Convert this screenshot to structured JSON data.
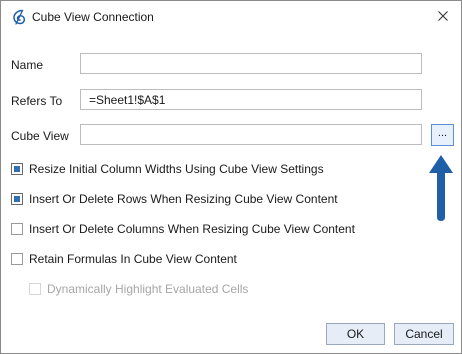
{
  "window": {
    "title": "Cube View Connection",
    "icon": "onestream-logo-icon",
    "close_icon": "close-icon"
  },
  "fields": {
    "name": {
      "label": "Name",
      "value": ""
    },
    "refers_to": {
      "label": "Refers To",
      "value": "=Sheet1!$A$1"
    },
    "cube_view": {
      "label": "Cube View",
      "value": "",
      "browse_label": "..."
    }
  },
  "options": [
    {
      "label": "Resize Initial Column Widths Using Cube View Settings",
      "checked": true,
      "enabled": true
    },
    {
      "label": "Insert Or Delete Rows When Resizing Cube View Content",
      "checked": true,
      "enabled": true
    },
    {
      "label": "Insert Or Delete Columns When Resizing Cube View Content",
      "checked": false,
      "enabled": true
    },
    {
      "label": "Retain Formulas In Cube View Content",
      "checked": false,
      "enabled": true
    },
    {
      "label": "Dynamically Highlight Evaluated Cells",
      "checked": false,
      "enabled": false
    }
  ],
  "buttons": {
    "ok": "OK",
    "cancel": "Cancel"
  },
  "annotation": {
    "icon": "up-arrow-icon",
    "color": "#1f5fa8"
  },
  "colors": {
    "accent": "#2f6fb3",
    "button_bg": "#e6edf7"
  }
}
